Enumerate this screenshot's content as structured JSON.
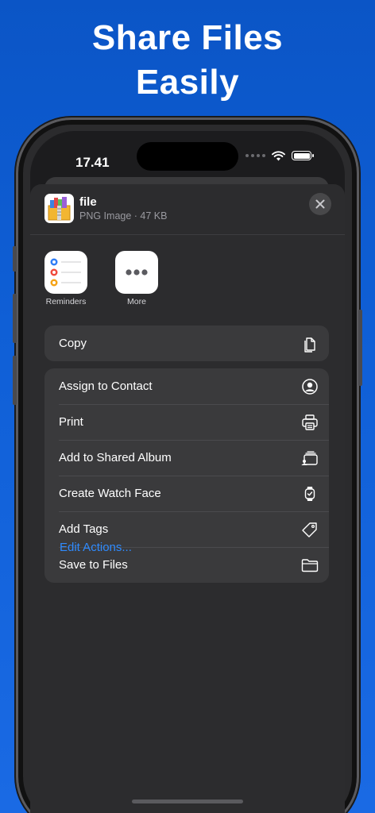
{
  "headline": {
    "line1": "Share Files",
    "line2": "Easily"
  },
  "status_bar": {
    "time": "17.41"
  },
  "share_sheet": {
    "file": {
      "name": "file",
      "meta": "PNG Image · 47 KB",
      "thumb_icon": "archive-box-icon"
    },
    "close_icon": "close-icon",
    "apps": [
      {
        "label": "Reminders",
        "icon": "reminders-icon"
      },
      {
        "label": "More",
        "icon": "more-icon"
      }
    ],
    "copy_group": [
      {
        "label": "Copy",
        "icon": "copy-icon"
      }
    ],
    "actions": [
      {
        "label": "Assign to Contact",
        "icon": "person-circle-icon"
      },
      {
        "label": "Print",
        "icon": "printer-icon"
      },
      {
        "label": "Add to Shared Album",
        "icon": "shared-album-icon"
      },
      {
        "label": "Create Watch Face",
        "icon": "watch-icon"
      },
      {
        "label": "Add Tags",
        "icon": "tag-icon"
      },
      {
        "label": "Save to Files",
        "icon": "folder-icon"
      }
    ],
    "edit_actions": "Edit Actions..."
  },
  "colors": {
    "background": "#0f5fd6",
    "sheet": "#2c2c2e",
    "row": "#3a3a3c",
    "link": "#2f8bff"
  }
}
